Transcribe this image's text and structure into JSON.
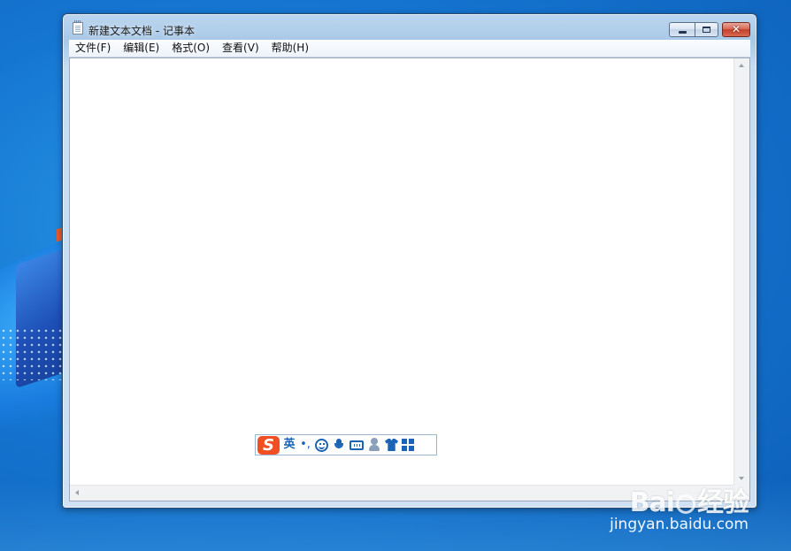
{
  "window": {
    "title": "新建文本文档 - 记事本"
  },
  "menu": {
    "items": [
      {
        "label": "文件(F)"
      },
      {
        "label": "编辑(E)"
      },
      {
        "label": "格式(O)"
      },
      {
        "label": "查看(V)"
      },
      {
        "label": "帮助(H)"
      }
    ]
  },
  "controls": {
    "minimize_icon": "minimize-icon",
    "maximize_icon": "maximize-icon",
    "close_icon": "close-icon"
  },
  "ime": {
    "logo_letter": "S",
    "mode_label": "英",
    "punct_label": "•,",
    "icons": [
      "emoji-icon",
      "microphone-icon",
      "keyboard-icon",
      "user-icon",
      "skin-icon",
      "toolbox-icon"
    ]
  },
  "watermark": {
    "logo_text_a": "Bai",
    "logo_text_b": "经验",
    "url": "jingyan.baidu.com"
  },
  "colors": {
    "desktop": "#1576d2",
    "ime_accent": "#1a63b5",
    "ime_logo": "#f04e23",
    "close_button": "#c3402b"
  }
}
